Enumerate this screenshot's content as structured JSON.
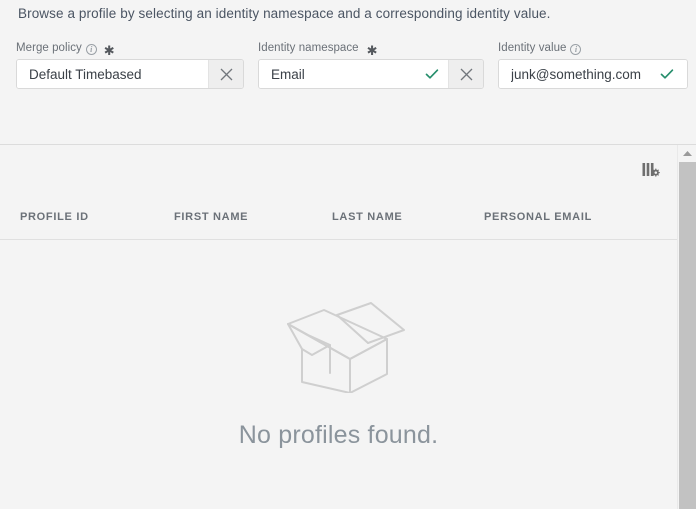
{
  "page": {
    "description": "Browse a profile by selecting an identity namespace and a corresponding identity value."
  },
  "form": {
    "fields": [
      {
        "name": "merge-policy",
        "label": "Merge policy",
        "has_info_icon": true,
        "required_marker": "✱",
        "required": true,
        "value": "Default Timebased",
        "valid_check": false,
        "clear_button": true,
        "clear_label": "×"
      },
      {
        "name": "identity-namespace",
        "label": "Identity namespace",
        "has_info_icon": false,
        "required_marker": "✱",
        "required": true,
        "value": "Email",
        "valid_check": true,
        "clear_button": true,
        "clear_label": "×"
      },
      {
        "name": "identity-value",
        "label": "Identity value",
        "has_info_icon": true,
        "required_marker": "",
        "required": false,
        "value": "junk@something.com",
        "valid_check": true,
        "clear_button": false,
        "clear_label": ""
      }
    ]
  },
  "table": {
    "settings_icon": "column-settings-icon",
    "columns": [
      "PROFILE ID",
      "FIRST NAME",
      "LAST NAME",
      "PERSONAL EMAIL"
    ],
    "rows": [],
    "empty_state": {
      "illustration": "empty-box-icon",
      "message": "No profiles found."
    }
  },
  "scrollbar": {
    "up_arrow": "chevron-up-icon",
    "visible": true
  },
  "colors": {
    "page_background": "#f4f4f4",
    "field_background": "#ffffff",
    "valid_check": "#268e6c",
    "text_primary": "#3b4148",
    "text_muted": "#6b7178",
    "empty_text": "#8b949c",
    "border": "#d9d9d9",
    "scrollbar_thumb": "#c2c2c2"
  }
}
